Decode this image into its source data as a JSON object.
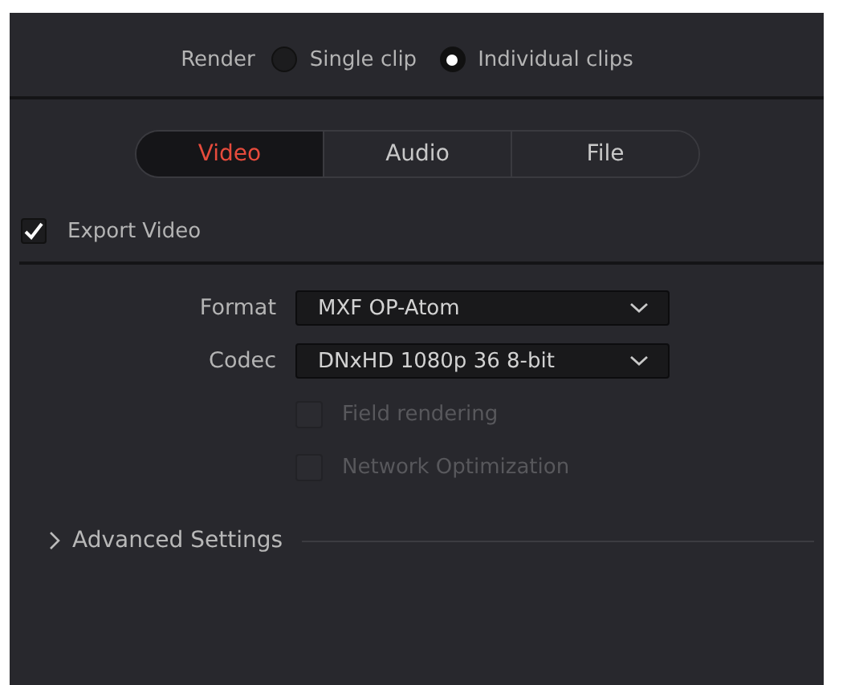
{
  "render": {
    "label": "Render",
    "options": [
      {
        "label": "Single clip",
        "selected": false
      },
      {
        "label": "Individual clips",
        "selected": true
      }
    ]
  },
  "tabs": [
    {
      "label": "Video",
      "selected": true
    },
    {
      "label": "Audio",
      "selected": false
    },
    {
      "label": "File",
      "selected": false
    }
  ],
  "export_video": {
    "label": "Export Video",
    "checked": true
  },
  "fields": [
    {
      "label": "Format",
      "value": "MXF OP-Atom"
    },
    {
      "label": "Codec",
      "value": "DNxHD 1080p 36 8-bit"
    }
  ],
  "options": [
    {
      "label": "Field rendering",
      "checked": false,
      "disabled": true
    },
    {
      "label": "Network Optimization",
      "checked": false,
      "disabled": true
    }
  ],
  "advanced": {
    "label": "Advanced Settings",
    "expanded": false
  }
}
